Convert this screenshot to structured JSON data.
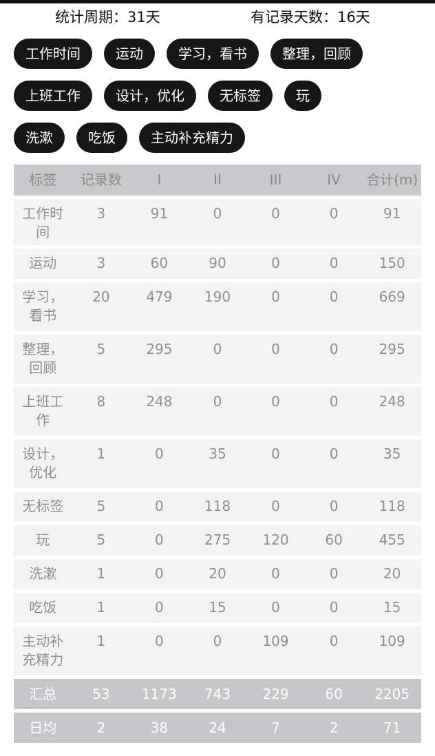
{
  "stats": {
    "period": "统计周期：31天",
    "record_days": "有记录天数：16天"
  },
  "tags": [
    [
      "工作时间",
      "运动",
      "学习，看书",
      "整理，回顾"
    ],
    [
      "上班工作",
      "设计，优化",
      "无标签",
      "玩"
    ],
    [
      "洗漱",
      "吃饭",
      "主动补充精力"
    ]
  ],
  "table": {
    "headers": [
      "标签",
      "记录数",
      "I",
      "II",
      "III",
      "IV",
      "合计(m)"
    ],
    "rows": [
      {
        "label": "工作时间",
        "values": [
          "3",
          "91",
          "0",
          "0",
          "0",
          "91"
        ]
      },
      {
        "label": "运动",
        "values": [
          "3",
          "60",
          "90",
          "0",
          "0",
          "150"
        ]
      },
      {
        "label": "学习，看书",
        "values": [
          "20",
          "479",
          "190",
          "0",
          "0",
          "669"
        ]
      },
      {
        "label": "整理，回顾",
        "values": [
          "5",
          "295",
          "0",
          "0",
          "0",
          "295"
        ]
      },
      {
        "label": "上班工作",
        "values": [
          "8",
          "248",
          "0",
          "0",
          "0",
          "248"
        ]
      },
      {
        "label": "设计，优化",
        "values": [
          "1",
          "0",
          "35",
          "0",
          "0",
          "35"
        ]
      },
      {
        "label": "无标签",
        "values": [
          "5",
          "0",
          "118",
          "0",
          "0",
          "118"
        ]
      },
      {
        "label": "玩",
        "values": [
          "5",
          "0",
          "275",
          "120",
          "60",
          "455"
        ]
      },
      {
        "label": "洗漱",
        "values": [
          "1",
          "0",
          "20",
          "0",
          "0",
          "20"
        ]
      },
      {
        "label": "吃饭",
        "values": [
          "1",
          "0",
          "15",
          "0",
          "0",
          "15"
        ]
      },
      {
        "label": "主动补充精力",
        "values": [
          "1",
          "0",
          "0",
          "109",
          "0",
          "109"
        ]
      }
    ],
    "summary": [
      {
        "label": "汇总",
        "values": [
          "53",
          "1173",
          "743",
          "229",
          "60",
          "2205"
        ]
      },
      {
        "label": "日均",
        "values": [
          "2",
          "38",
          "24",
          "7",
          "2",
          "71"
        ]
      }
    ]
  },
  "colors": {
    "chip_bg": "#161616",
    "chip_text": "#ffffff",
    "header_bg": "#c9c9cb",
    "row_bg": "#f3f3f3",
    "summary_bg": "#c6c6c8",
    "cell_text": "#8e8e8e"
  }
}
